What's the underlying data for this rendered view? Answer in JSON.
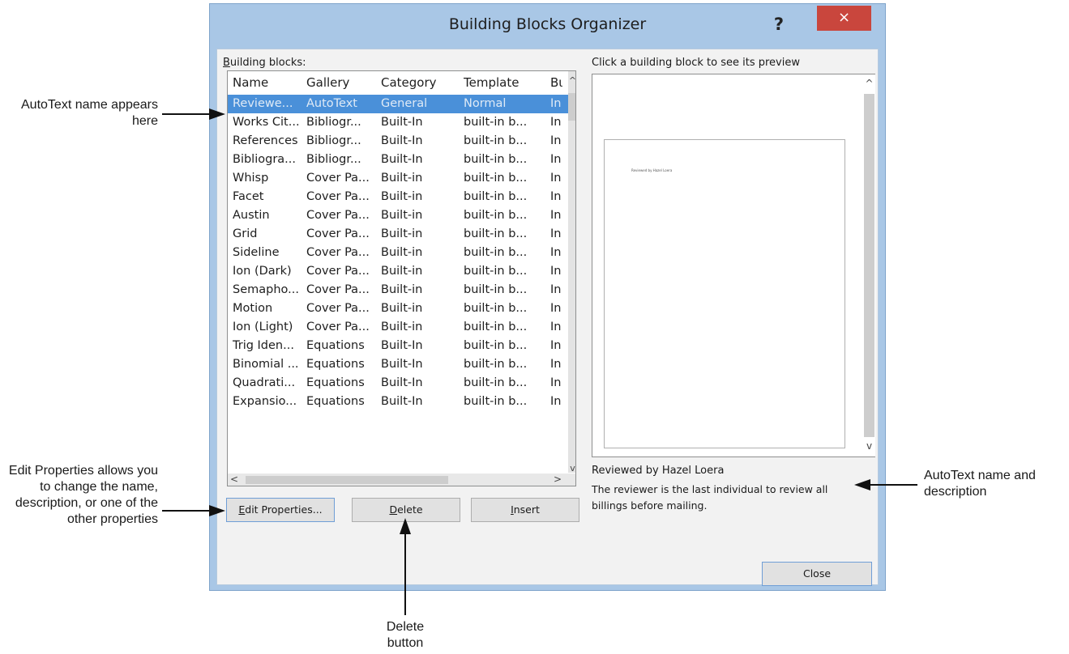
{
  "dialog": {
    "title": "Building Blocks Organizer",
    "help": "?",
    "close_x": "×"
  },
  "list": {
    "label_accel": "B",
    "label_rest": "uilding blocks:",
    "columns": [
      "Name",
      "Gallery",
      "Category",
      "Template",
      "Bι"
    ],
    "rows": [
      [
        "Reviewe...",
        "AutoText",
        "General",
        "Normal",
        "In"
      ],
      [
        "Works Cit...",
        "Bibliogr...",
        "Built-In",
        "built-in b...",
        "In"
      ],
      [
        "References",
        "Bibliogr...",
        "Built-In",
        "built-in b...",
        "In"
      ],
      [
        "Bibliogra...",
        "Bibliogr...",
        "Built-In",
        "built-in b...",
        "In"
      ],
      [
        "Whisp",
        "Cover Pa...",
        "Built-in",
        "built-in b...",
        "In"
      ],
      [
        "Facet",
        "Cover Pa...",
        "Built-in",
        "built-in b...",
        "In"
      ],
      [
        "Austin",
        "Cover Pa...",
        "Built-in",
        "built-in b...",
        "In"
      ],
      [
        "Grid",
        "Cover Pa...",
        "Built-in",
        "built-in b...",
        "In"
      ],
      [
        "Sideline",
        "Cover Pa...",
        "Built-in",
        "built-in b...",
        "In"
      ],
      [
        "Ion (Dark)",
        "Cover Pa...",
        "Built-in",
        "built-in b...",
        "In"
      ],
      [
        "Semapho...",
        "Cover Pa...",
        "Built-in",
        "built-in b...",
        "In"
      ],
      [
        "Motion",
        "Cover Pa...",
        "Built-in",
        "built-in b...",
        "In"
      ],
      [
        "Ion (Light)",
        "Cover Pa...",
        "Built-in",
        "built-in b...",
        "In"
      ],
      [
        "Trig Iden...",
        "Equations",
        "Built-In",
        "built-in b...",
        "In"
      ],
      [
        "Binomial ...",
        "Equations",
        "Built-In",
        "built-in b...",
        "In"
      ],
      [
        "Quadrati...",
        "Equations",
        "Built-In",
        "built-in b...",
        "In"
      ],
      [
        "Expansio...",
        "Equations",
        "Built-In",
        "built-in b...",
        "In"
      ]
    ],
    "selected_row": 0
  },
  "buttons": {
    "edit_accel": "E",
    "edit_rest": "dit Properties...",
    "delete_accel": "D",
    "delete_rest": "elete",
    "insert_accel": "I",
    "insert_rest": "nsert",
    "close": "Close"
  },
  "preview": {
    "label": "Click a building block to see its preview",
    "page_text": "Reviewed by Hazel Loera",
    "block_name": "Reviewed by Hazel Loera",
    "block_description": "The reviewer is the last individual to review all billings before mailing."
  },
  "callouts": {
    "autotext_name": "AutoText name appears here",
    "edit_properties": "Edit Properties allows you to change the name, description, or one of the other properties",
    "name_and_description": "AutoText name and description",
    "delete_button": "Delete button"
  },
  "icons": {
    "scroll_up": "scroll-up-icon",
    "scroll_down": "scroll-down-icon",
    "scroll_left": "scroll-left-icon",
    "scroll_right": "scroll-right-icon"
  },
  "colors": {
    "selection": "#4a90d9",
    "close_x_bg": "#c9463d",
    "frame": "#a9c7e6"
  }
}
